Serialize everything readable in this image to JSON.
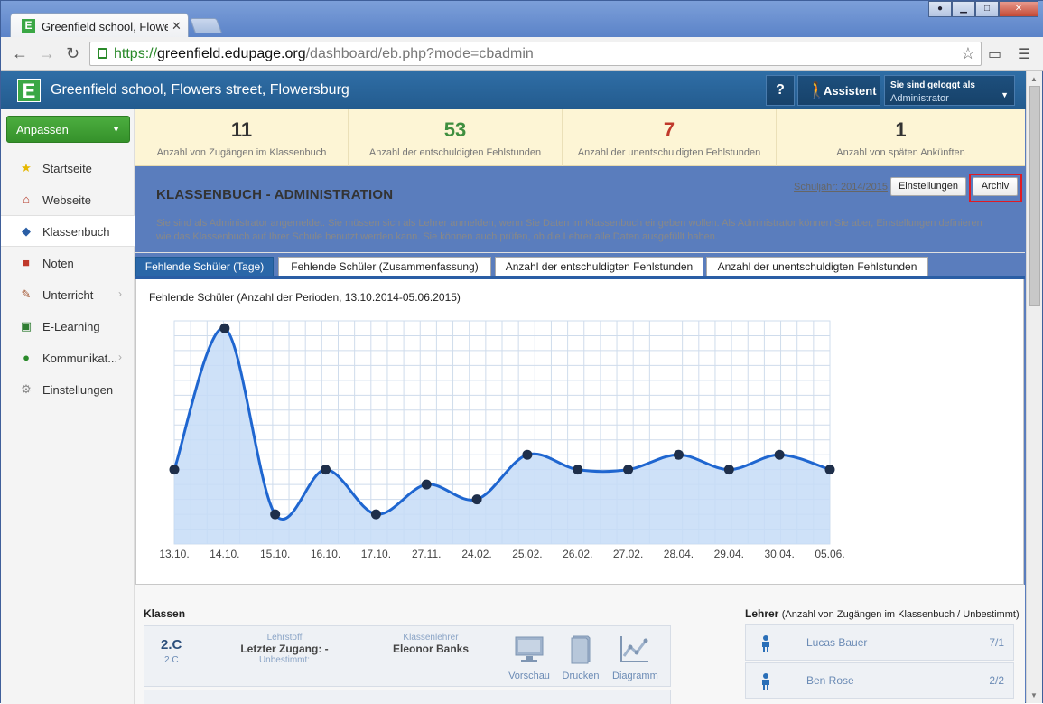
{
  "browser": {
    "tab_title": "Greenfield school, Flowers street",
    "url_scheme": "https://",
    "url_host": "greenfield.edupage.org",
    "url_path": "/dashboard/eb.php?mode=cbadmin"
  },
  "app": {
    "name": "Greenfield school, Flowers street, Flowersburg",
    "logo_letter": "E",
    "help_label": "?",
    "assistant_label": "Assistent",
    "user_line1": "Sie sind geloggt als",
    "user_line2": "Administrator"
  },
  "sidebar": {
    "customize_label": "Anpassen",
    "items": [
      {
        "label": "Startseite",
        "icon": "star-icon"
      },
      {
        "label": "Webseite",
        "icon": "house-icon"
      },
      {
        "label": "Klassenbuch",
        "icon": "book-icon"
      },
      {
        "label": "Noten",
        "icon": "grades-icon"
      },
      {
        "label": "Unterricht",
        "icon": "lesson-icon"
      },
      {
        "label": "E-Learning",
        "icon": "elearning-icon"
      },
      {
        "label": "Kommunikat...",
        "icon": "globe-icon"
      },
      {
        "label": "Einstellungen",
        "icon": "gear-icon"
      }
    ]
  },
  "stats": [
    {
      "value": "11",
      "label": "Anzahl von Zugängen im Klassenbuch",
      "color": "#333333"
    },
    {
      "value": "53",
      "label": "Anzahl der entschuldigten Fehlstunden",
      "color": "#3f8f3f"
    },
    {
      "value": "7",
      "label": "Anzahl der unentschuldigten Fehlstunden",
      "color": "#c0392b"
    },
    {
      "value": "1",
      "label": "Anzahl von späten Ankünften",
      "color": "#333333"
    }
  ],
  "main": {
    "title": "KLASSENBUCH - ADMINISTRATION",
    "schuljahr": "Schuljahr: 2014/2015",
    "settings_button": "Einstellungen",
    "archive_button": "Archiv",
    "info": "Sie sind als Administrator angemeldet. Sie müssen sich als Lehrer anmelden, wenn Sie Daten im Klassenbuch eingeben wollen. Als Administrator können Sie aber, Einstellungen definieren wie das Klassenbuch auf Ihrer Schule benutzt werden kann. Sie können auch prüfen, ob die Lehrer alle Daten ausgefüllt haben.",
    "tabs": [
      "Fehlende Schüler (Tage)",
      "Fehlende Schüler (Zusammenfassung)",
      "Anzahl der entschuldigten Fehlstunden",
      "Anzahl der unentschuldigten Fehlstunden"
    ]
  },
  "chart_data": {
    "type": "area",
    "title": "Fehlende Schüler (Anzahl der Perioden, 13.10.2014-05.06.2015)",
    "categories": [
      "13.10.",
      "14.10.",
      "15.10.",
      "16.10.",
      "17.10.",
      "27.11.",
      "24.02.",
      "25.02.",
      "26.02.",
      "27.02.",
      "28.04.",
      "29.04.",
      "30.04.",
      "05.06."
    ],
    "values": [
      5,
      14.5,
      2,
      5,
      2,
      4,
      3,
      6,
      5,
      5,
      6,
      5,
      6,
      5
    ],
    "ylim": [
      0,
      15
    ],
    "grid": true,
    "line_color": "#1f66d0",
    "fill_color": "#c6dcf7"
  },
  "klassen": {
    "heading": "Klassen",
    "rows": [
      {
        "name": "2.C",
        "short": "2.C",
        "lehrstoff_label": "Lehrstoff",
        "letzter_zugang": "Letzter Zugang: -",
        "unbestimmt": "Unbestimmt:",
        "klassenlehrer_label": "Klassenlehrer",
        "klassenlehrer": "Eleonor Banks",
        "actions": [
          "Vorschau",
          "Drucken",
          "Diagramm"
        ]
      }
    ]
  },
  "lehrer": {
    "heading": "Lehrer",
    "sub": "(Anzahl von Zugängen im Klassenbuch / Unbestimmt)",
    "rows": [
      {
        "name": "Lucas Bauer",
        "count": "7/1"
      },
      {
        "name": "Ben Rose",
        "count": "2/2"
      }
    ]
  }
}
